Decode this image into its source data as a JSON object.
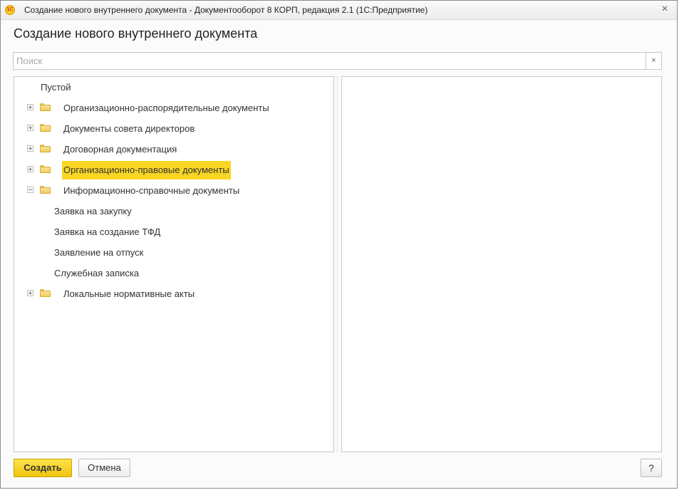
{
  "window": {
    "title": "Создание нового внутреннего документа - Документооборот 8 КОРП, редакция 2.1  (1С:Предприятие)",
    "logo_text": "1C",
    "close_label": "×"
  },
  "header": {
    "title": "Создание нового внутреннего документа"
  },
  "search": {
    "placeholder": "Поиск",
    "value": "",
    "clear_label": "×"
  },
  "tree": {
    "empty_item": "Пустой",
    "folders": [
      {
        "label": "Организационно-распорядительные документы",
        "expanded": false
      },
      {
        "label": "Документы совета директоров",
        "expanded": false
      },
      {
        "label": "Договорная документация",
        "expanded": false
      },
      {
        "label": "Организационно-правовые документы",
        "expanded": false,
        "selected": true
      },
      {
        "label": "Информационно-справочные документы",
        "expanded": true
      }
    ],
    "children": [
      "Заявка на закупку",
      "Заявка на создание ТФД",
      "Заявление на отпуск",
      "Служебная записка"
    ],
    "last_folder": {
      "label": "Локальные нормативные акты",
      "expanded": false
    }
  },
  "buttons": {
    "create": "Создать",
    "cancel": "Отмена",
    "help": "?"
  },
  "colors": {
    "selection": "#f9d624",
    "primary_button": "#f1c40f"
  }
}
